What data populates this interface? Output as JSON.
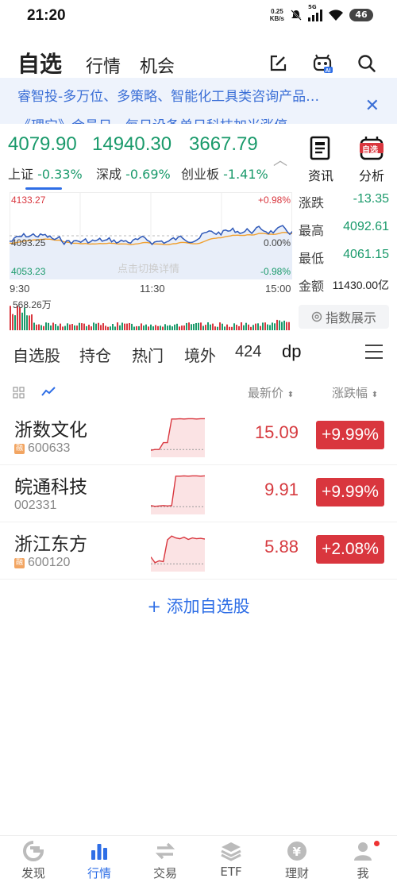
{
  "status_bar": {
    "time": "21:20",
    "net_speed_top": "0.25",
    "net_speed_bottom": "KB/s",
    "network": "5G",
    "battery": "46"
  },
  "header": {
    "tabs": [
      "自选",
      "行情",
      "机会"
    ],
    "active_tab": "自选"
  },
  "notice": {
    "text": "睿智投-多万位、多策略、智能化工具类咨询产品…",
    "text2": "《理它》会员日…每日设备单日科技加米涨停"
  },
  "indices": [
    {
      "value": "4079.90",
      "name": "上证",
      "change": "-0.33%"
    },
    {
      "value": "14940.30",
      "name": "深成",
      "change": "-0.69%"
    },
    {
      "value": "3667.79",
      "name": "创业板",
      "change": "-1.41%"
    }
  ],
  "side_buttons": {
    "news": "资讯",
    "analysis": "分析",
    "analysis_badge": "自选"
  },
  "intraday": {
    "high_label": "4133.27",
    "high_pct": "+0.98%",
    "mid_label": "4093.25",
    "mid_pct": "0.00%",
    "low_label": "4053.23",
    "low_pct": "-0.98%",
    "watermark": "点击切换详情",
    "time_start": "9:30",
    "time_mid": "11:30",
    "time_end": "15:00",
    "volume_label": "568.26万"
  },
  "stats": [
    {
      "label": "涨跌",
      "value": "-13.35"
    },
    {
      "label": "最高",
      "value": "4092.61"
    },
    {
      "label": "最低",
      "value": "4061.15"
    },
    {
      "label": "金额",
      "value": "11430.00亿"
    }
  ],
  "index_display_button": "指数展示",
  "watchlist_tabs": [
    "自选股",
    "持仓",
    "热门",
    "境外",
    "424",
    "dp"
  ],
  "list_header": {
    "price": "最新价",
    "change": "涨跌幅"
  },
  "stocks": [
    {
      "name": "浙数文化",
      "code": "600633",
      "rong": "融",
      "price": "15.09",
      "change": "+9.99%",
      "spark": [
        0.1,
        0.12,
        0.12,
        0.3,
        0.3,
        0.92,
        0.92,
        0.93,
        0.92,
        0.93,
        0.93,
        0.92,
        0.93,
        0.93
      ]
    },
    {
      "name": "皖通科技",
      "code": "002331",
      "rong": "",
      "price": "9.91",
      "change": "+9.99%",
      "spark": [
        0.15,
        0.13,
        0.14,
        0.15,
        0.14,
        0.15,
        0.92,
        0.92,
        0.93,
        0.92,
        0.93,
        0.93,
        0.92,
        0.93
      ]
    },
    {
      "name": "浙江东方",
      "code": "600120",
      "rong": "融",
      "price": "5.88",
      "change": "+2.08%",
      "spark": [
        0.3,
        0.15,
        0.2,
        0.18,
        0.75,
        0.85,
        0.8,
        0.78,
        0.82,
        0.76,
        0.8,
        0.78,
        0.79,
        0.77
      ]
    }
  ],
  "add_button": "添加自选股",
  "bottom_nav": [
    {
      "label": "发现",
      "icon": "discover-icon"
    },
    {
      "label": "行情",
      "icon": "market-icon"
    },
    {
      "label": "交易",
      "icon": "trade-icon"
    },
    {
      "label": "ETF",
      "icon": "etf-icon"
    },
    {
      "label": "理财",
      "icon": "wealth-icon"
    },
    {
      "label": "我",
      "icon": "profile-icon"
    }
  ],
  "colors": {
    "up": "#d9363e",
    "down": "#1a9a6b",
    "accent": "#2e6ee6",
    "index_line": "#2e58b8",
    "avg_line": "#f0a030"
  }
}
